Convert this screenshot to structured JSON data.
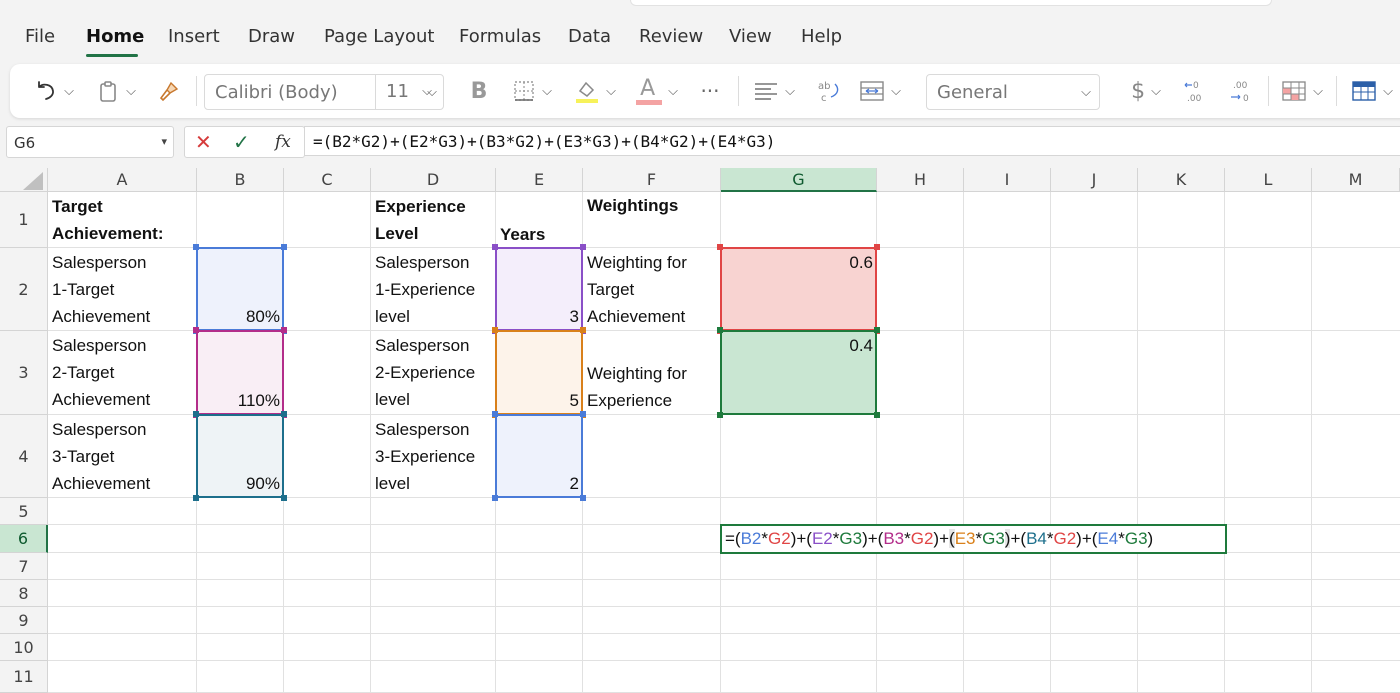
{
  "menu": {
    "tabs": [
      "File",
      "Home",
      "Insert",
      "Draw",
      "Page Layout",
      "Formulas",
      "Data",
      "Review",
      "View",
      "Help"
    ],
    "active_tab": "Home"
  },
  "ribbon": {
    "font_name": "Calibri (Body)",
    "font_size": "11",
    "bold_label": "B",
    "font_color_label": "A",
    "more_label": "···",
    "number_format": "General",
    "currency_label": "$",
    "increase_decimal_label": ".0 .00",
    "decrease_decimal_label": ".00 .0"
  },
  "formula_bar": {
    "name_box": "G6",
    "fx_label": "fx",
    "formula": "=(B2*G2)+(E2*G3)+(B3*G2)+(E3*G3)+(B4*G2)+(E4*G3)"
  },
  "grid": {
    "columns": [
      "A",
      "B",
      "C",
      "D",
      "E",
      "F",
      "G",
      "H",
      "I",
      "J",
      "K",
      "L",
      "M"
    ],
    "rows": [
      "1",
      "2",
      "3",
      "4",
      "5",
      "6",
      "7",
      "8",
      "9",
      "10",
      "11"
    ],
    "selected_column": "G",
    "selected_row": "6"
  },
  "cells": {
    "A1": [
      "Target",
      "Achievement:"
    ],
    "D1": [
      "Experience",
      "Level"
    ],
    "E1": [
      "Years"
    ],
    "F1": [
      "Weightings"
    ],
    "A2": [
      "Salesperson",
      "1-Target",
      "Achievement"
    ],
    "A3": [
      "Salesperson",
      "2-Target",
      "Achievement"
    ],
    "A4": [
      "Salesperson",
      "3-Target",
      "Achievement"
    ],
    "D2": [
      "Salesperson",
      "1-Experience",
      "level"
    ],
    "D3": [
      "Salesperson",
      "2-Experience",
      "level"
    ],
    "D4": [
      "Salesperson",
      "3-Experience",
      "level"
    ],
    "F2": [
      "Weighting for",
      "Target",
      "Achievement"
    ],
    "F3": [
      "Weighting for",
      "Experience"
    ],
    "B2": "80%",
    "B3": "110%",
    "B4": "90%",
    "E2": "3",
    "E3": "5",
    "E4": "2",
    "G2": "0.6",
    "G3": "0.4"
  },
  "edit_formula": [
    {
      "t": "=(",
      "ref": null
    },
    {
      "t": "B2",
      "ref": "B2"
    },
    {
      "t": "*",
      "ref": null
    },
    {
      "t": "G2",
      "ref": "G2"
    },
    {
      "t": ")+(",
      "ref": null
    },
    {
      "t": "E2",
      "ref": "E2"
    },
    {
      "t": "*",
      "ref": null
    },
    {
      "t": "G3",
      "ref": "G3"
    },
    {
      "t": ")+(",
      "ref": null
    },
    {
      "t": "B3",
      "ref": "B3"
    },
    {
      "t": "*",
      "ref": null
    },
    {
      "t": "G2",
      "ref": "G2"
    },
    {
      "t": ")+",
      "ref": null
    },
    {
      "t": "(",
      "ref": "cursor"
    },
    {
      "t": "E3",
      "ref": "E3"
    },
    {
      "t": "*",
      "ref": null
    },
    {
      "t": "G3",
      "ref": "G3"
    },
    {
      "t": ")",
      "ref": "cursor"
    },
    {
      "t": "+(",
      "ref": null
    },
    {
      "t": "B4",
      "ref": "B4"
    },
    {
      "t": "*",
      "ref": null
    },
    {
      "t": "G2",
      "ref": "G2"
    },
    {
      "t": ")+(",
      "ref": null
    },
    {
      "t": "E4",
      "ref": "E4"
    },
    {
      "t": "*",
      "ref": null
    },
    {
      "t": "G3",
      "ref": "G3"
    },
    {
      "t": ")",
      "ref": null
    }
  ],
  "ref_colors": {
    "B2": "#4a7bd8",
    "E2": "#8a4fc7",
    "B3": "#b32d8a",
    "E3": "#d9801a",
    "B4": "#1d6f8c",
    "E4": "#4a7bd8",
    "G2": "#e04545",
    "G3": "#1e7a3c"
  },
  "ref_fills": {
    "B2": "#eef2fc",
    "E2": "#f4eefb",
    "B3": "#f9eef5",
    "E3": "#fdf3ea",
    "B4": "#eef3f6",
    "E4": "#eef2fc",
    "G2": "#f8d3d1",
    "G3": "#c9e6d2"
  }
}
